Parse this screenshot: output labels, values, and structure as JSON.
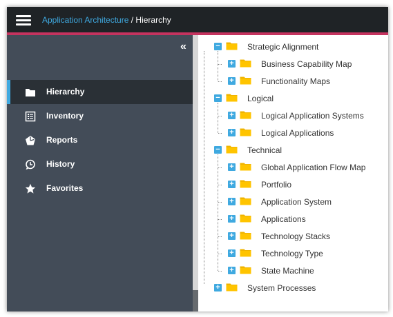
{
  "header": {
    "breadcrumb_parent": "Application Architecture",
    "breadcrumb_separator": " / ",
    "breadcrumb_current": "Hierarchy"
  },
  "sidebar": {
    "collapse_glyph": "«",
    "items": [
      {
        "label": "Hierarchy",
        "icon": "folder-icon",
        "active": true
      },
      {
        "label": "Inventory",
        "icon": "list-icon",
        "active": false
      },
      {
        "label": "Reports",
        "icon": "chart-icon",
        "active": false
      },
      {
        "label": "History",
        "icon": "history-icon",
        "active": false
      },
      {
        "label": "Favorites",
        "icon": "star-icon",
        "active": false
      }
    ]
  },
  "tree": {
    "groups": [
      {
        "label": "Strategic Alignment",
        "expanded": true,
        "children": [
          "Business Capability Map",
          "Functionality Maps"
        ]
      },
      {
        "label": "Logical",
        "expanded": true,
        "children": [
          "Logical Application Systems",
          "Logical Applications"
        ]
      },
      {
        "label": "Technical",
        "expanded": true,
        "children": [
          "Global Application Flow Map",
          "Portfolio",
          "Application System",
          "Applications",
          "Technology Stacks",
          "Technology Type",
          "State Machine"
        ]
      },
      {
        "label": "System Processes",
        "expanded": false,
        "children": []
      }
    ]
  },
  "colors": {
    "topbar": "#1f2326",
    "accent": "#c5335f",
    "sidebar": "#434c58",
    "active_item": "#2a3036",
    "link": "#3fa9e0",
    "folder": "#f0b400"
  }
}
